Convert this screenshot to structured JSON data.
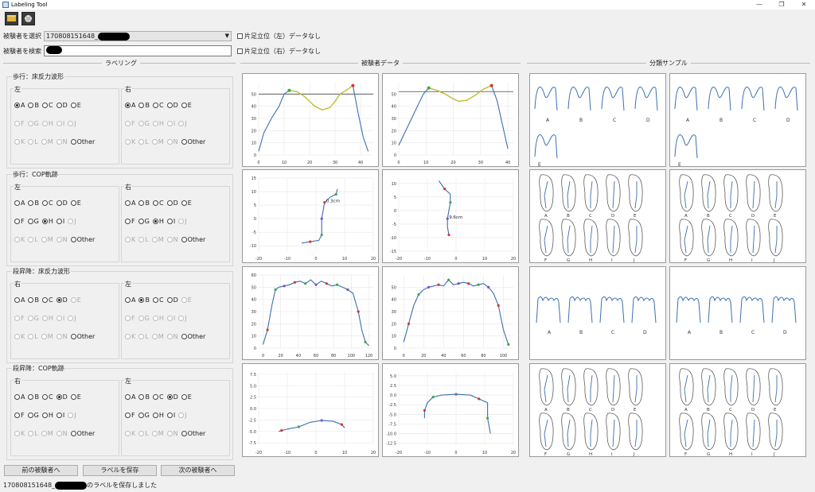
{
  "window": {
    "title": "Labeling Tool",
    "controls": [
      "—",
      "❐",
      "✕"
    ]
  },
  "subject_select": {
    "label": "被験者を選択",
    "value_prefix": "170808151648_"
  },
  "subject_search": {
    "label": "被験者を検索",
    "placeholder": ""
  },
  "checks": {
    "left_single": "片足立位（左）データなし",
    "right_single": "片足立位（右）データなし"
  },
  "sections": {
    "labeling": "ラベリング",
    "subject_data": "被験者データ",
    "samples": "分類サンプル"
  },
  "groups": [
    {
      "title": "歩行：床反力波形",
      "subs": [
        {
          "title": "左",
          "rows": [
            [
              [
                "A",
                1,
                0
              ],
              [
                "B",
                0,
                0
              ],
              [
                "C",
                0,
                0
              ],
              [
                "D",
                0,
                0
              ],
              [
                "E",
                0,
                0
              ]
            ],
            [
              [
                "F",
                0,
                1
              ],
              [
                "G",
                0,
                1
              ],
              [
                "H",
                0,
                1
              ],
              [
                "I",
                0,
                1
              ],
              [
                "J",
                0,
                1
              ]
            ],
            [
              [
                "K",
                0,
                1
              ],
              [
                "L",
                0,
                1
              ],
              [
                "M",
                0,
                1
              ],
              [
                "N",
                0,
                1
              ],
              [
                "Other",
                0,
                0
              ]
            ]
          ]
        },
        {
          "title": "右",
          "rows": [
            [
              [
                "A",
                1,
                0
              ],
              [
                "B",
                0,
                0
              ],
              [
                "C",
                0,
                0
              ],
              [
                "D",
                0,
                0
              ],
              [
                "E",
                0,
                0
              ]
            ],
            [
              [
                "F",
                0,
                1
              ],
              [
                "G",
                0,
                1
              ],
              [
                "H",
                0,
                1
              ],
              [
                "I",
                0,
                1
              ],
              [
                "J",
                0,
                1
              ]
            ],
            [
              [
                "K",
                0,
                1
              ],
              [
                "L",
                0,
                1
              ],
              [
                "M",
                0,
                1
              ],
              [
                "N",
                0,
                1
              ],
              [
                "Other",
                0,
                0
              ]
            ]
          ]
        }
      ]
    },
    {
      "title": "歩行：COP軌跡",
      "subs": [
        {
          "title": "左",
          "rows": [
            [
              [
                "A",
                0,
                0
              ],
              [
                "B",
                0,
                0
              ],
              [
                "C",
                0,
                0
              ],
              [
                "D",
                0,
                0
              ],
              [
                "E",
                0,
                0
              ]
            ],
            [
              [
                "F",
                0,
                0
              ],
              [
                "G",
                0,
                0
              ],
              [
                "H",
                1,
                0
              ],
              [
                "I",
                0,
                0
              ],
              [
                "J",
                0,
                1
              ]
            ],
            [
              [
                "K",
                0,
                1
              ],
              [
                "L",
                0,
                1
              ],
              [
                "M",
                0,
                1
              ],
              [
                "N",
                0,
                1
              ],
              [
                "Other",
                0,
                0
              ]
            ]
          ]
        },
        {
          "title": "右",
          "rows": [
            [
              [
                "A",
                0,
                0
              ],
              [
                "B",
                0,
                0
              ],
              [
                "C",
                0,
                0
              ],
              [
                "D",
                0,
                0
              ],
              [
                "E",
                0,
                0
              ]
            ],
            [
              [
                "F",
                0,
                0
              ],
              [
                "G",
                0,
                0
              ],
              [
                "H",
                1,
                0
              ],
              [
                "I",
                0,
                0
              ],
              [
                "J",
                0,
                1
              ]
            ],
            [
              [
                "K",
                0,
                1
              ],
              [
                "L",
                0,
                1
              ],
              [
                "M",
                0,
                1
              ],
              [
                "N",
                0,
                1
              ],
              [
                "Other",
                0,
                0
              ]
            ]
          ]
        }
      ]
    },
    {
      "title": "段昇降：床反力波形",
      "subs": [
        {
          "title": "右",
          "rows": [
            [
              [
                "A",
                0,
                0
              ],
              [
                "B",
                0,
                0
              ],
              [
                "C",
                0,
                0
              ],
              [
                "D",
                1,
                0
              ],
              [
                "E",
                0,
                1
              ]
            ],
            [
              [
                "F",
                0,
                1
              ],
              [
                "G",
                0,
                1
              ],
              [
                "H",
                0,
                1
              ],
              [
                "I",
                0,
                1
              ],
              [
                "J",
                0,
                1
              ]
            ],
            [
              [
                "K",
                0,
                1
              ],
              [
                "L",
                0,
                1
              ],
              [
                "M",
                0,
                1
              ],
              [
                "N",
                0,
                1
              ],
              [
                "Other",
                0,
                0
              ]
            ]
          ]
        },
        {
          "title": "左",
          "rows": [
            [
              [
                "A",
                0,
                0
              ],
              [
                "B",
                1,
                0
              ],
              [
                "C",
                0,
                0
              ],
              [
                "D",
                0,
                0
              ],
              [
                "E",
                0,
                1
              ]
            ],
            [
              [
                "F",
                0,
                1
              ],
              [
                "G",
                0,
                1
              ],
              [
                "H",
                0,
                1
              ],
              [
                "I",
                0,
                1
              ],
              [
                "J",
                0,
                1
              ]
            ],
            [
              [
                "K",
                0,
                1
              ],
              [
                "L",
                0,
                1
              ],
              [
                "M",
                0,
                1
              ],
              [
                "N",
                0,
                1
              ],
              [
                "Other",
                0,
                0
              ]
            ]
          ]
        }
      ]
    },
    {
      "title": "段昇降：COP軌跡",
      "subs": [
        {
          "title": "右",
          "rows": [
            [
              [
                "A",
                0,
                0
              ],
              [
                "B",
                0,
                0
              ],
              [
                "C",
                0,
                0
              ],
              [
                "D",
                1,
                0
              ],
              [
                "E",
                0,
                0
              ]
            ],
            [
              [
                "F",
                0,
                0
              ],
              [
                "G",
                0,
                0
              ],
              [
                "H",
                0,
                0
              ],
              [
                "I",
                0,
                0
              ],
              [
                "J",
                0,
                1
              ]
            ],
            [
              [
                "K",
                0,
                1
              ],
              [
                "L",
                0,
                1
              ],
              [
                "M",
                0,
                1
              ],
              [
                "N",
                0,
                1
              ],
              [
                "Other",
                0,
                0
              ]
            ]
          ]
        },
        {
          "title": "左",
          "rows": [
            [
              [
                "A",
                0,
                0
              ],
              [
                "B",
                0,
                0
              ],
              [
                "C",
                0,
                0
              ],
              [
                "D",
                1,
                0
              ],
              [
                "E",
                0,
                0
              ]
            ],
            [
              [
                "F",
                0,
                0
              ],
              [
                "G",
                0,
                0
              ],
              [
                "H",
                0,
                0
              ],
              [
                "I",
                0,
                0
              ],
              [
                "J",
                0,
                1
              ]
            ],
            [
              [
                "K",
                0,
                1
              ],
              [
                "L",
                0,
                1
              ],
              [
                "M",
                0,
                1
              ],
              [
                "N",
                0,
                1
              ],
              [
                "Other",
                0,
                0
              ]
            ]
          ]
        }
      ]
    }
  ],
  "buttons": {
    "prev": "前の被験者へ",
    "save": "ラベルを保存",
    "next": "次の被験者へ"
  },
  "status": {
    "prefix": "170808151648_",
    "suffix": "のラベルを保存しました"
  },
  "colors": {
    "line": "#3b6fb0",
    "highlight": "#c9c21a",
    "green": "#3aa845",
    "red": "#d9342b",
    "purple": "#7a52c6"
  },
  "chart_data": [
    {
      "type": "line",
      "title": "",
      "xticks": [
        "0",
        "10",
        "20",
        "30",
        "40"
      ],
      "yticks": [
        "0",
        "10",
        "20",
        "30",
        "40",
        "50"
      ],
      "xlim": [
        0,
        45
      ],
      "ylim": [
        0,
        60
      ],
      "x": [
        0,
        2,
        5,
        8,
        10,
        12,
        15,
        18,
        20,
        22,
        25,
        28,
        30,
        32,
        35,
        37,
        39,
        41,
        43
      ],
      "y": [
        3,
        18,
        30,
        40,
        50,
        53,
        52,
        48,
        44,
        40,
        37,
        39,
        44,
        50,
        54,
        57,
        35,
        15,
        3
      ],
      "reference_y": 50,
      "green_x": 12,
      "red_x": 37
    },
    {
      "type": "line",
      "title": "",
      "xticks": [
        "0",
        "10",
        "20",
        "30",
        "40"
      ],
      "yticks": [
        "0",
        "10",
        "20",
        "30",
        "40",
        "50"
      ],
      "xlim": [
        0,
        42
      ],
      "ylim": [
        0,
        60
      ],
      "x": [
        0,
        3,
        6,
        9,
        11,
        14,
        17,
        20,
        22,
        25,
        28,
        31,
        34,
        36,
        38,
        40
      ],
      "y": [
        8,
        22,
        36,
        50,
        55,
        53,
        50,
        46,
        44,
        45,
        49,
        54,
        57,
        45,
        25,
        5
      ],
      "reference_y": 52,
      "green_x": 11,
      "red_x": 34
    },
    {
      "type": "scatter",
      "title": "",
      "annotation": "0.3cm",
      "xticks": [
        "-20",
        "-10",
        "0",
        "10",
        "20"
      ],
      "yticks": [
        "-10",
        "-5",
        "0",
        "5",
        "10",
        "15"
      ],
      "xlim": [
        -20,
        20
      ],
      "ylim": [
        -12,
        15
      ],
      "x": [
        -5,
        -2,
        1,
        2,
        2,
        2,
        2.5,
        3,
        5,
        7,
        7.5
      ],
      "y": [
        -9,
        -8.5,
        -8,
        -6,
        -3,
        0,
        3,
        6,
        8,
        9,
        11
      ]
    },
    {
      "type": "scatter",
      "title": "",
      "annotation": "9.6cm",
      "xticks": [
        "-20",
        "-10",
        "0",
        "10",
        "20"
      ],
      "yticks": [
        "-15",
        "-10",
        "-5",
        "0",
        "5",
        "10"
      ],
      "xlim": [
        -20,
        20
      ],
      "ylim": [
        -15,
        12
      ],
      "x": [
        -6,
        -4,
        -2,
        -2,
        -2.5,
        -3,
        -3,
        -2.5
      ],
      "y": [
        11,
        8,
        6,
        3,
        0,
        -3,
        -6,
        -9
      ]
    },
    {
      "type": "line",
      "title": "",
      "xticks": [
        "0",
        "20",
        "40",
        "60",
        "80",
        "100",
        "120"
      ],
      "yticks": [
        "0",
        "10",
        "20",
        "30",
        "40",
        "50",
        "60"
      ],
      "xlim": [
        -5,
        125
      ],
      "ylim": [
        0,
        60
      ],
      "x": [
        0,
        5,
        10,
        14,
        18,
        24,
        30,
        36,
        42,
        48,
        54,
        60,
        66,
        72,
        78,
        84,
        90,
        96,
        102,
        108,
        112,
        116,
        120
      ],
      "y": [
        3,
        15,
        35,
        48,
        50,
        51,
        52,
        54,
        55,
        53,
        56,
        52,
        55,
        53,
        51,
        52,
        50,
        48,
        45,
        30,
        15,
        5,
        2
      ]
    },
    {
      "type": "line",
      "title": "",
      "xticks": [
        "0",
        "20",
        "40",
        "60",
        "80",
        "100"
      ],
      "yticks": [
        "0",
        "10",
        "20",
        "30",
        "40",
        "50"
      ],
      "xlim": [
        -5,
        110
      ],
      "ylim": [
        0,
        60
      ],
      "x": [
        0,
        5,
        10,
        15,
        20,
        25,
        30,
        35,
        40,
        45,
        50,
        55,
        60,
        65,
        70,
        75,
        80,
        85,
        90,
        95,
        100,
        105
      ],
      "y": [
        5,
        20,
        35,
        44,
        48,
        50,
        51,
        52,
        51,
        56,
        52,
        53,
        54,
        53,
        51,
        52,
        53,
        50,
        45,
        35,
        15,
        3
      ]
    },
    {
      "type": "scatter",
      "title": "",
      "xticks": [
        "-20",
        "-10",
        "0",
        "10",
        "20"
      ],
      "yticks": [
        "-7.5",
        "-5.0",
        "-2.5",
        "0.0",
        "2.5",
        "5.0",
        "7.5"
      ],
      "xlim": [
        -20,
        20
      ],
      "ylim": [
        -8,
        8
      ],
      "x": [
        -13,
        -12,
        -10,
        -6,
        -2,
        2,
        6,
        9,
        10
      ],
      "y": [
        -5,
        -4.8,
        -4.5,
        -4,
        -3,
        -2.6,
        -2.8,
        -3.5,
        -4.2
      ]
    },
    {
      "type": "scatter",
      "title": "",
      "xticks": [
        "-20",
        "-10",
        "0",
        "10",
        "20"
      ],
      "yticks": [
        "-12.5",
        "-10.0",
        "-7.5",
        "-5.0",
        "-2.5",
        "0.0",
        "2.5",
        "5.0"
      ],
      "xlim": [
        -20,
        20
      ],
      "ylim": [
        -13,
        6
      ],
      "x": [
        -11,
        -11,
        -10,
        -8,
        -5,
        0,
        5,
        8,
        11,
        11,
        12
      ],
      "y": [
        -6,
        -4,
        -2,
        -0.5,
        0,
        0.2,
        0,
        -1,
        -2,
        -6,
        -10
      ]
    }
  ],
  "samples": {
    "wave_labels": [
      "A",
      "B",
      "C",
      "D",
      "E"
    ],
    "cop_labels_top": [
      "A",
      "B",
      "C",
      "D",
      "E"
    ],
    "cop_labels_bottom": [
      "F",
      "G",
      "H",
      "I",
      "J"
    ],
    "step_labels": [
      "A",
      "B",
      "C",
      "D"
    ]
  }
}
